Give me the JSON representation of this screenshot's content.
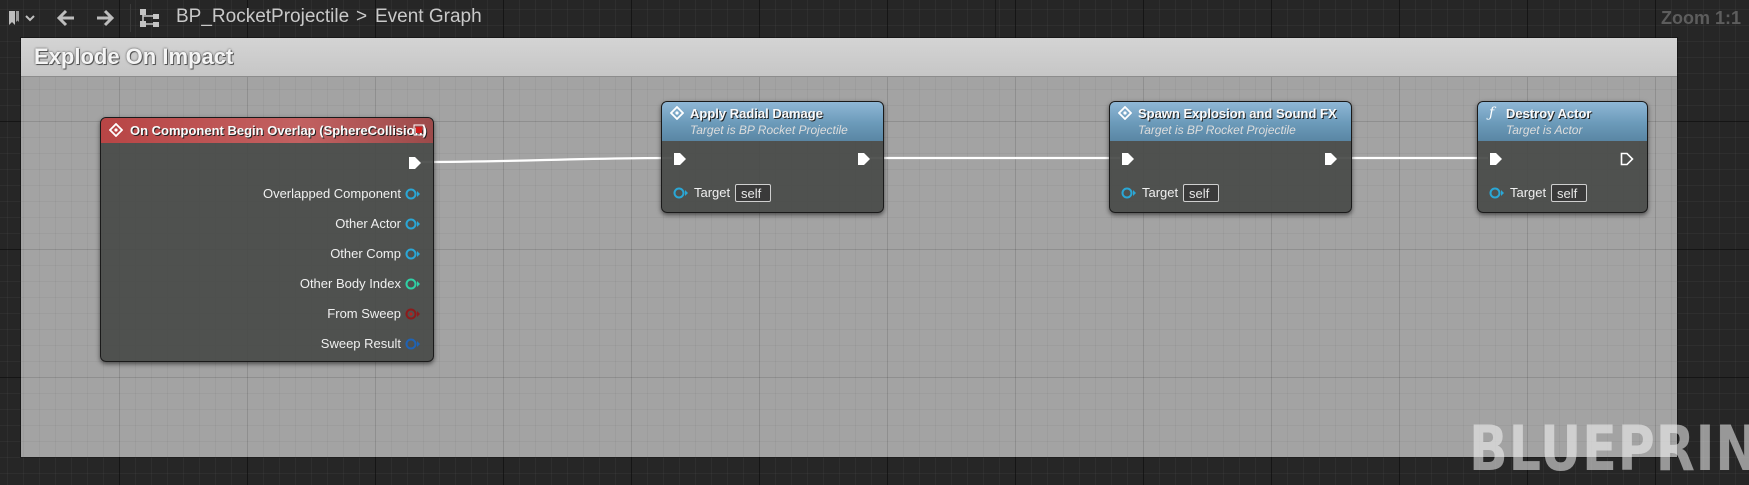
{
  "toolbar": {
    "breadcrumb_blueprint": "BP_RocketProjectile",
    "breadcrumb_separator": ">",
    "breadcrumb_graph": "Event Graph",
    "zoom": "Zoom 1:1"
  },
  "comment": {
    "title": "Explode On Impact"
  },
  "watermark": "BLUEPRINT",
  "nodes": {
    "overlap": {
      "title": "On Component Begin Overlap (SphereCollision)",
      "pins": [
        "Overlapped Component",
        "Other Actor",
        "Other Comp",
        "Other Body Index",
        "From Sweep",
        "Sweep Result"
      ]
    },
    "radial": {
      "title": "Apply Radial Damage",
      "subtitle": "Target is BP Rocket Projectile",
      "target_label": "Target",
      "target_value": "self"
    },
    "spawn": {
      "title": "Spawn Explosion and Sound FX",
      "subtitle": "Target is BP Rocket Projectile",
      "target_label": "Target",
      "target_value": "self"
    },
    "destroy": {
      "title": "Destroy Actor",
      "subtitle": "Target is Actor",
      "target_label": "Target",
      "target_value": "self"
    }
  },
  "colors": {
    "event_header": "#a63a3a",
    "function_header": "#6d9fbf",
    "object_pin": "#2aa7d6",
    "int_pin": "#2fd1a6",
    "bool_pin": "#8c1b1b",
    "struct_pin": "#1f63b5"
  }
}
